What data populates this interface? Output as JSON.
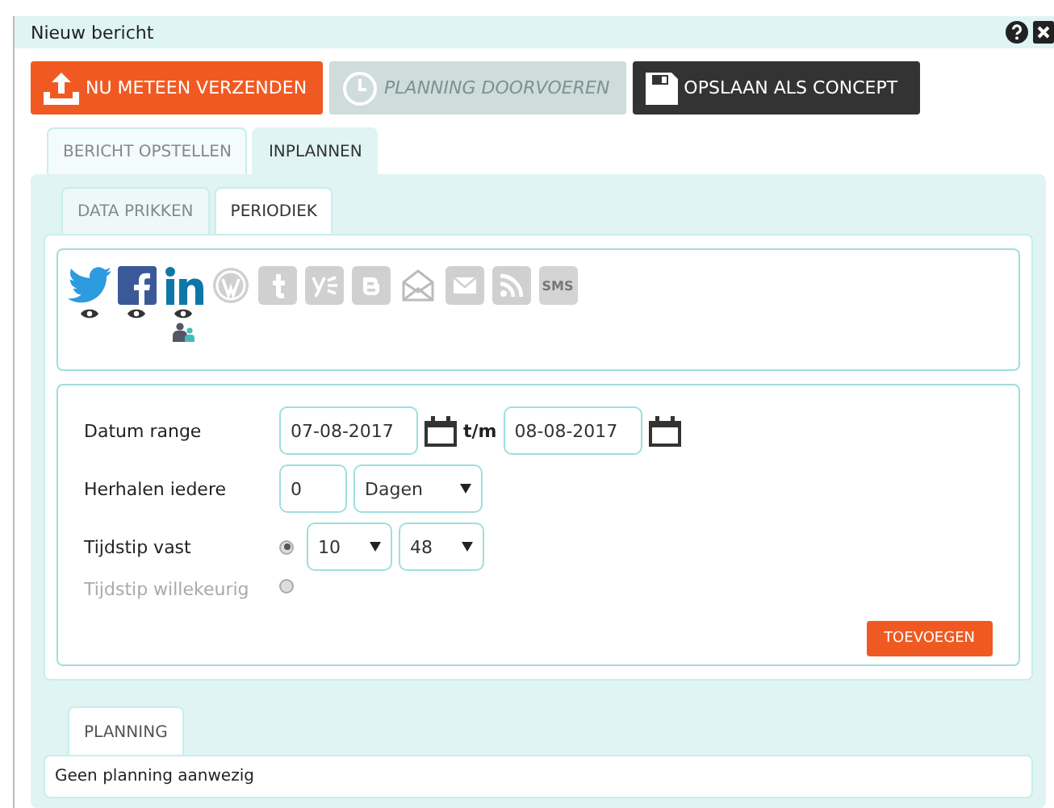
{
  "window": {
    "title": "Nieuw bericht"
  },
  "actions": [
    {
      "label": "NU METEEN VERZENDEN",
      "kind": "send",
      "disabled": false
    },
    {
      "label": "PLANNING DOORVOEREN",
      "kind": "schedule",
      "disabled": true
    },
    {
      "label": "OPSLAAN ALS CONCEPT",
      "kind": "save",
      "disabled": false
    }
  ],
  "tabs": [
    {
      "label": "BERICHT OPSTELLEN",
      "selected": false
    },
    {
      "label": "INPLANNEN",
      "selected": true
    }
  ],
  "subtabs": [
    {
      "label": "DATA PRIKKEN",
      "selected": false
    },
    {
      "label": "PERIODIEK",
      "selected": true
    }
  ],
  "networks": [
    {
      "kind": "twitter",
      "enabled": true,
      "preview": true,
      "audience": false
    },
    {
      "kind": "facebook",
      "enabled": true,
      "preview": true,
      "audience": false
    },
    {
      "kind": "linkedin",
      "enabled": true,
      "preview": true,
      "audience": true
    },
    {
      "kind": "wordpress",
      "enabled": false,
      "preview": false,
      "audience": false
    },
    {
      "kind": "tumblr",
      "enabled": false,
      "preview": false,
      "audience": false
    },
    {
      "kind": "yammer",
      "enabled": false,
      "preview": false,
      "audience": false
    },
    {
      "kind": "blogger",
      "enabled": false,
      "preview": false,
      "audience": false
    },
    {
      "kind": "newsletter",
      "enabled": false,
      "preview": false,
      "audience": false
    },
    {
      "kind": "email",
      "enabled": false,
      "preview": false,
      "audience": false
    },
    {
      "kind": "rss",
      "enabled": false,
      "preview": false,
      "audience": false
    },
    {
      "kind": "sms",
      "label": "SMS",
      "enabled": false,
      "preview": false,
      "audience": false
    }
  ],
  "form": {
    "date_range": {
      "label": "Datum range",
      "from": "07-08-2017",
      "separator": "t/m",
      "to": "08-08-2017"
    },
    "repeat": {
      "label": "Herhalen iedere",
      "value": "0",
      "unit": "Dagen"
    },
    "fixed_time": {
      "label": "Tijdstip vast",
      "selected": true,
      "hour": "10",
      "minute": "48"
    },
    "random_time": {
      "label": "Tijdstip willekeurig",
      "selected": false
    },
    "add_button": "TOEVOEGEN"
  },
  "planning": {
    "tab": "PLANNING",
    "message": "Geen planning aanwezig"
  }
}
